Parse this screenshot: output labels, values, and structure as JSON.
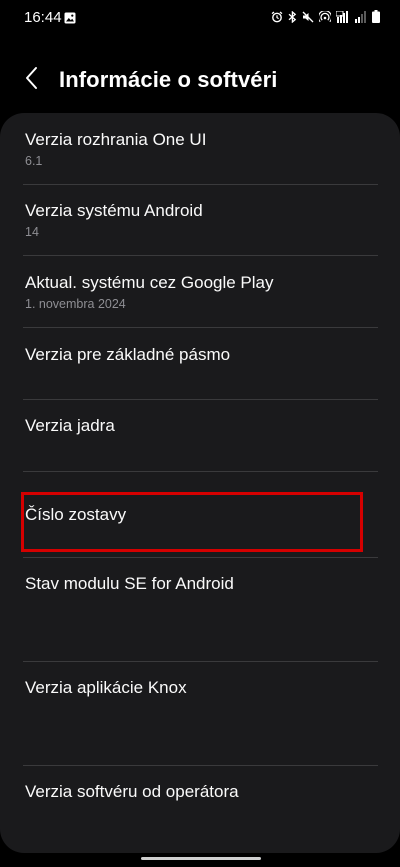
{
  "status_bar": {
    "time": "16:44",
    "icons": [
      "gallery-icon",
      "alarm-icon",
      "bluetooth-icon",
      "mute-icon",
      "hotspot-icon",
      "signal-icon",
      "wifi-signal-icon",
      "battery-icon"
    ]
  },
  "header": {
    "title": "Informácie o softvéri",
    "back_icon": "chevron-left-icon"
  },
  "items": [
    {
      "title": "Verzia rozhrania One UI",
      "subtitle": "6.1"
    },
    {
      "title": "Verzia systému Android",
      "subtitle": "14"
    },
    {
      "title": "Aktual. systému cez Google Play",
      "subtitle": "1. novembra 2024"
    },
    {
      "title": "Verzia pre základné pásmo",
      "subtitle": ""
    },
    {
      "title": "Verzia jadra",
      "subtitle": ""
    },
    {
      "title": "Číslo zostavy",
      "subtitle": ""
    },
    {
      "title": "Stav modulu SE for Android",
      "subtitle": ""
    },
    {
      "title": "Verzia aplikácie Knox",
      "subtitle": ""
    },
    {
      "title": "Verzia softvéru od operátora",
      "subtitle": ""
    }
  ],
  "colors": {
    "background": "#000000",
    "card": "#1a1a1c",
    "highlight": "#d50000",
    "subtitle": "#8e8e93"
  }
}
